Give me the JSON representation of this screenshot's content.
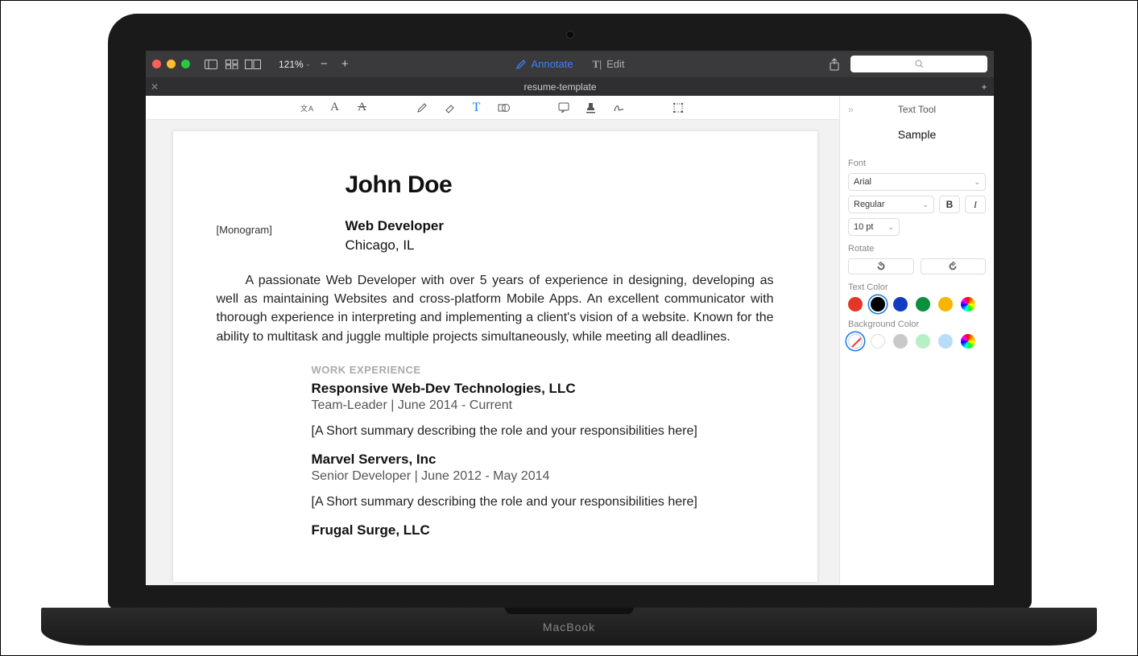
{
  "toolbar": {
    "zoom": "121%",
    "annotate_label": "Annotate",
    "edit_label": "Edit"
  },
  "tab": {
    "title": "resume-template"
  },
  "inspector": {
    "title": "Text Tool",
    "sample": "Sample",
    "font_label": "Font",
    "font_value": "Arial",
    "weight_value": "Regular",
    "size_value": "10 pt",
    "rotate_label": "Rotate",
    "text_color_label": "Text Color",
    "bg_color_label": "Background Color",
    "text_colors": [
      "#e53628",
      "#000000",
      "#103dc2",
      "#0a8f3c",
      "#f7b500"
    ],
    "text_color_selected": 1,
    "bg_colors_special": [
      "none",
      "#ffffff",
      "#c9c9c9",
      "#b7f0c3",
      "#b9dcf9"
    ],
    "bg_color_selected": 0
  },
  "document": {
    "name": "John Doe",
    "monogram": "[Monogram]",
    "role": "Web Developer",
    "location": "Chicago, IL",
    "summary": "A passionate Web Developer with over 5 years of experience in designing, developing as well as maintaining Websites and cross-platform Mobile Apps. An excellent communicator with thorough experience in interpreting and implementing a client's vision of a website. Known for the ability to multitask and juggle multiple projects simultaneously, while meeting all deadlines.",
    "section_work": "WORK EXPERIENCE",
    "jobs": [
      {
        "company": "Responsive Web-Dev Technologies, LLC",
        "sub": "Team-Leader | June 2014 - Current",
        "desc": "[A Short summary describing the role and your responsibilities here]"
      },
      {
        "company": "Marvel Servers, Inc",
        "sub": "Senior Developer | June 2012 - May 2014",
        "desc": "[A Short summary describing the role and your responsibilities here]"
      },
      {
        "company": "Frugal Surge, LLC",
        "sub": "",
        "desc": ""
      }
    ]
  },
  "laptop_brand": "MacBook"
}
